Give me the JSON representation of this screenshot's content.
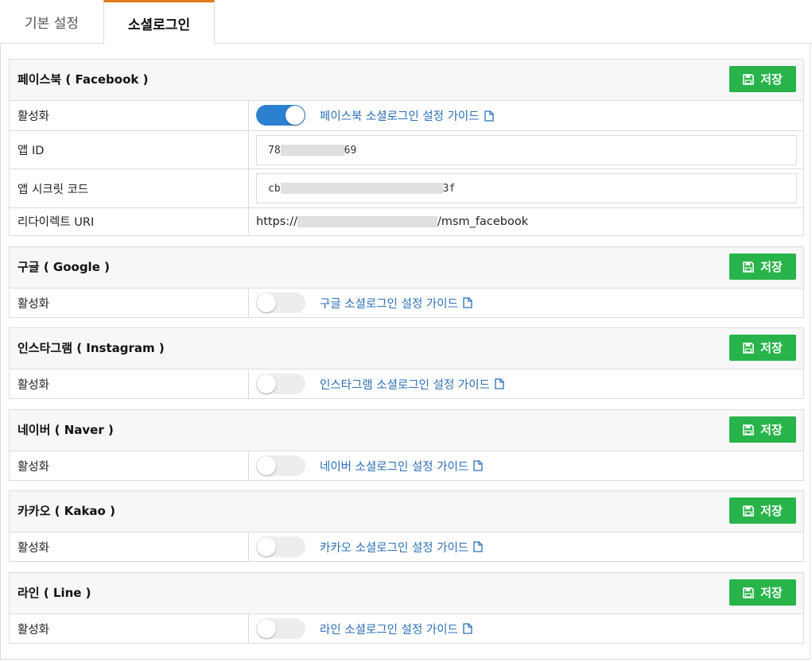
{
  "tabs": [
    {
      "label": "기본 설정",
      "active": false
    },
    {
      "label": "소셜로그인",
      "active": true
    }
  ],
  "colors": {
    "accent_tab": "#e07b1f",
    "save_button": "#28b44a",
    "toggle_on": "#2b80d0",
    "link": "#2b6fb8"
  },
  "save_label": "저장",
  "activate_label": "활성화",
  "facebook": {
    "title": "페이스북 ( Facebook )",
    "enabled": true,
    "guide": "페이스북 소셜로그인 설정 가이드",
    "app_id_label": "앱 ID",
    "app_id_prefix": "78",
    "app_id_suffix": "69",
    "secret_label": "앱 시크릿 코드",
    "secret_prefix": "cb",
    "secret_suffix": "3f",
    "redirect_label": "리다이렉트 URI",
    "redirect_prefix": "https://",
    "redirect_suffix": "/msm_facebook"
  },
  "google": {
    "title": "구글 ( Google )",
    "enabled": false,
    "guide": "구글 소셜로그인 설정 가이드"
  },
  "instagram": {
    "title": "인스타그램 ( Instagram )",
    "enabled": false,
    "guide": "인스타그램 소셜로그인 설정 가이드"
  },
  "naver": {
    "title": "네이버 ( Naver )",
    "enabled": false,
    "guide": "네이버 소셜로그인 설정 가이드"
  },
  "kakao": {
    "title": "카카오 ( Kakao )",
    "enabled": false,
    "guide": "카카오 소셜로그인 설정 가이드"
  },
  "line": {
    "title": "라인 ( Line )",
    "enabled": false,
    "guide": "라인 소셜로그인 설정 가이드"
  }
}
